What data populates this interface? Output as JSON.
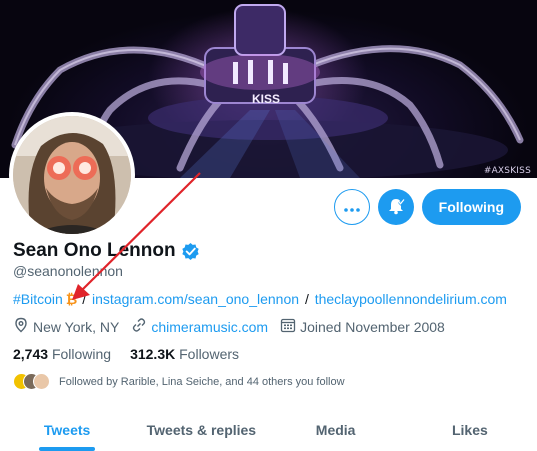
{
  "banner": {
    "watermark": "#AXSKISS"
  },
  "profile": {
    "name": "Sean Ono Lennon",
    "handle": "@seanonolennon",
    "verified_icon": "verified-badge-icon"
  },
  "actions": {
    "more_icon": "more-dots-icon",
    "bell_icon": "notification-bell-icon",
    "following_label": "Following"
  },
  "bio": {
    "hashtag": "#Bitcoin",
    "emoji": "₿",
    "separator": "/",
    "link1": "instagram.com/sean_ono_lennon",
    "link2": "theclaypoollennondelirium.com"
  },
  "meta": {
    "location": "New York, NY",
    "website": "chimeramusic.com",
    "joined": "Joined November 2008"
  },
  "counts": {
    "following_value": "2,743",
    "following_label": "Following",
    "followers_value": "312.3K",
    "followers_label": "Followers"
  },
  "followed_by": {
    "text": "Followed by Rarible, Lina Seiche, and 44 others you follow"
  },
  "tabs": [
    {
      "label": "Tweets",
      "active": true
    },
    {
      "label": "Tweets & replies",
      "active": false
    },
    {
      "label": "Media",
      "active": false
    },
    {
      "label": "Likes",
      "active": false
    }
  ],
  "colors": {
    "accent": "#1d9bf0",
    "bitcoin": "#f7931a",
    "annotation_arrow": "#e0242a",
    "text_secondary": "#536471"
  }
}
